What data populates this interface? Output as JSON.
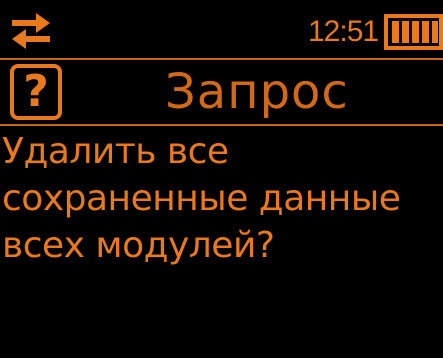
{
  "colors": {
    "background": "#000000",
    "accent": "#e8791c",
    "divider": "#c96516"
  },
  "status_bar": {
    "left_icon": "transfer-arrows-icon",
    "time": "12:51",
    "battery_icon": "battery-full-icon",
    "battery_level": 1.0
  },
  "header": {
    "icon": "question-icon",
    "icon_glyph": "?",
    "title": "Запрос"
  },
  "message": {
    "lines": [
      "Удалить все",
      "сохраненные данные",
      "всех модулей?"
    ]
  }
}
